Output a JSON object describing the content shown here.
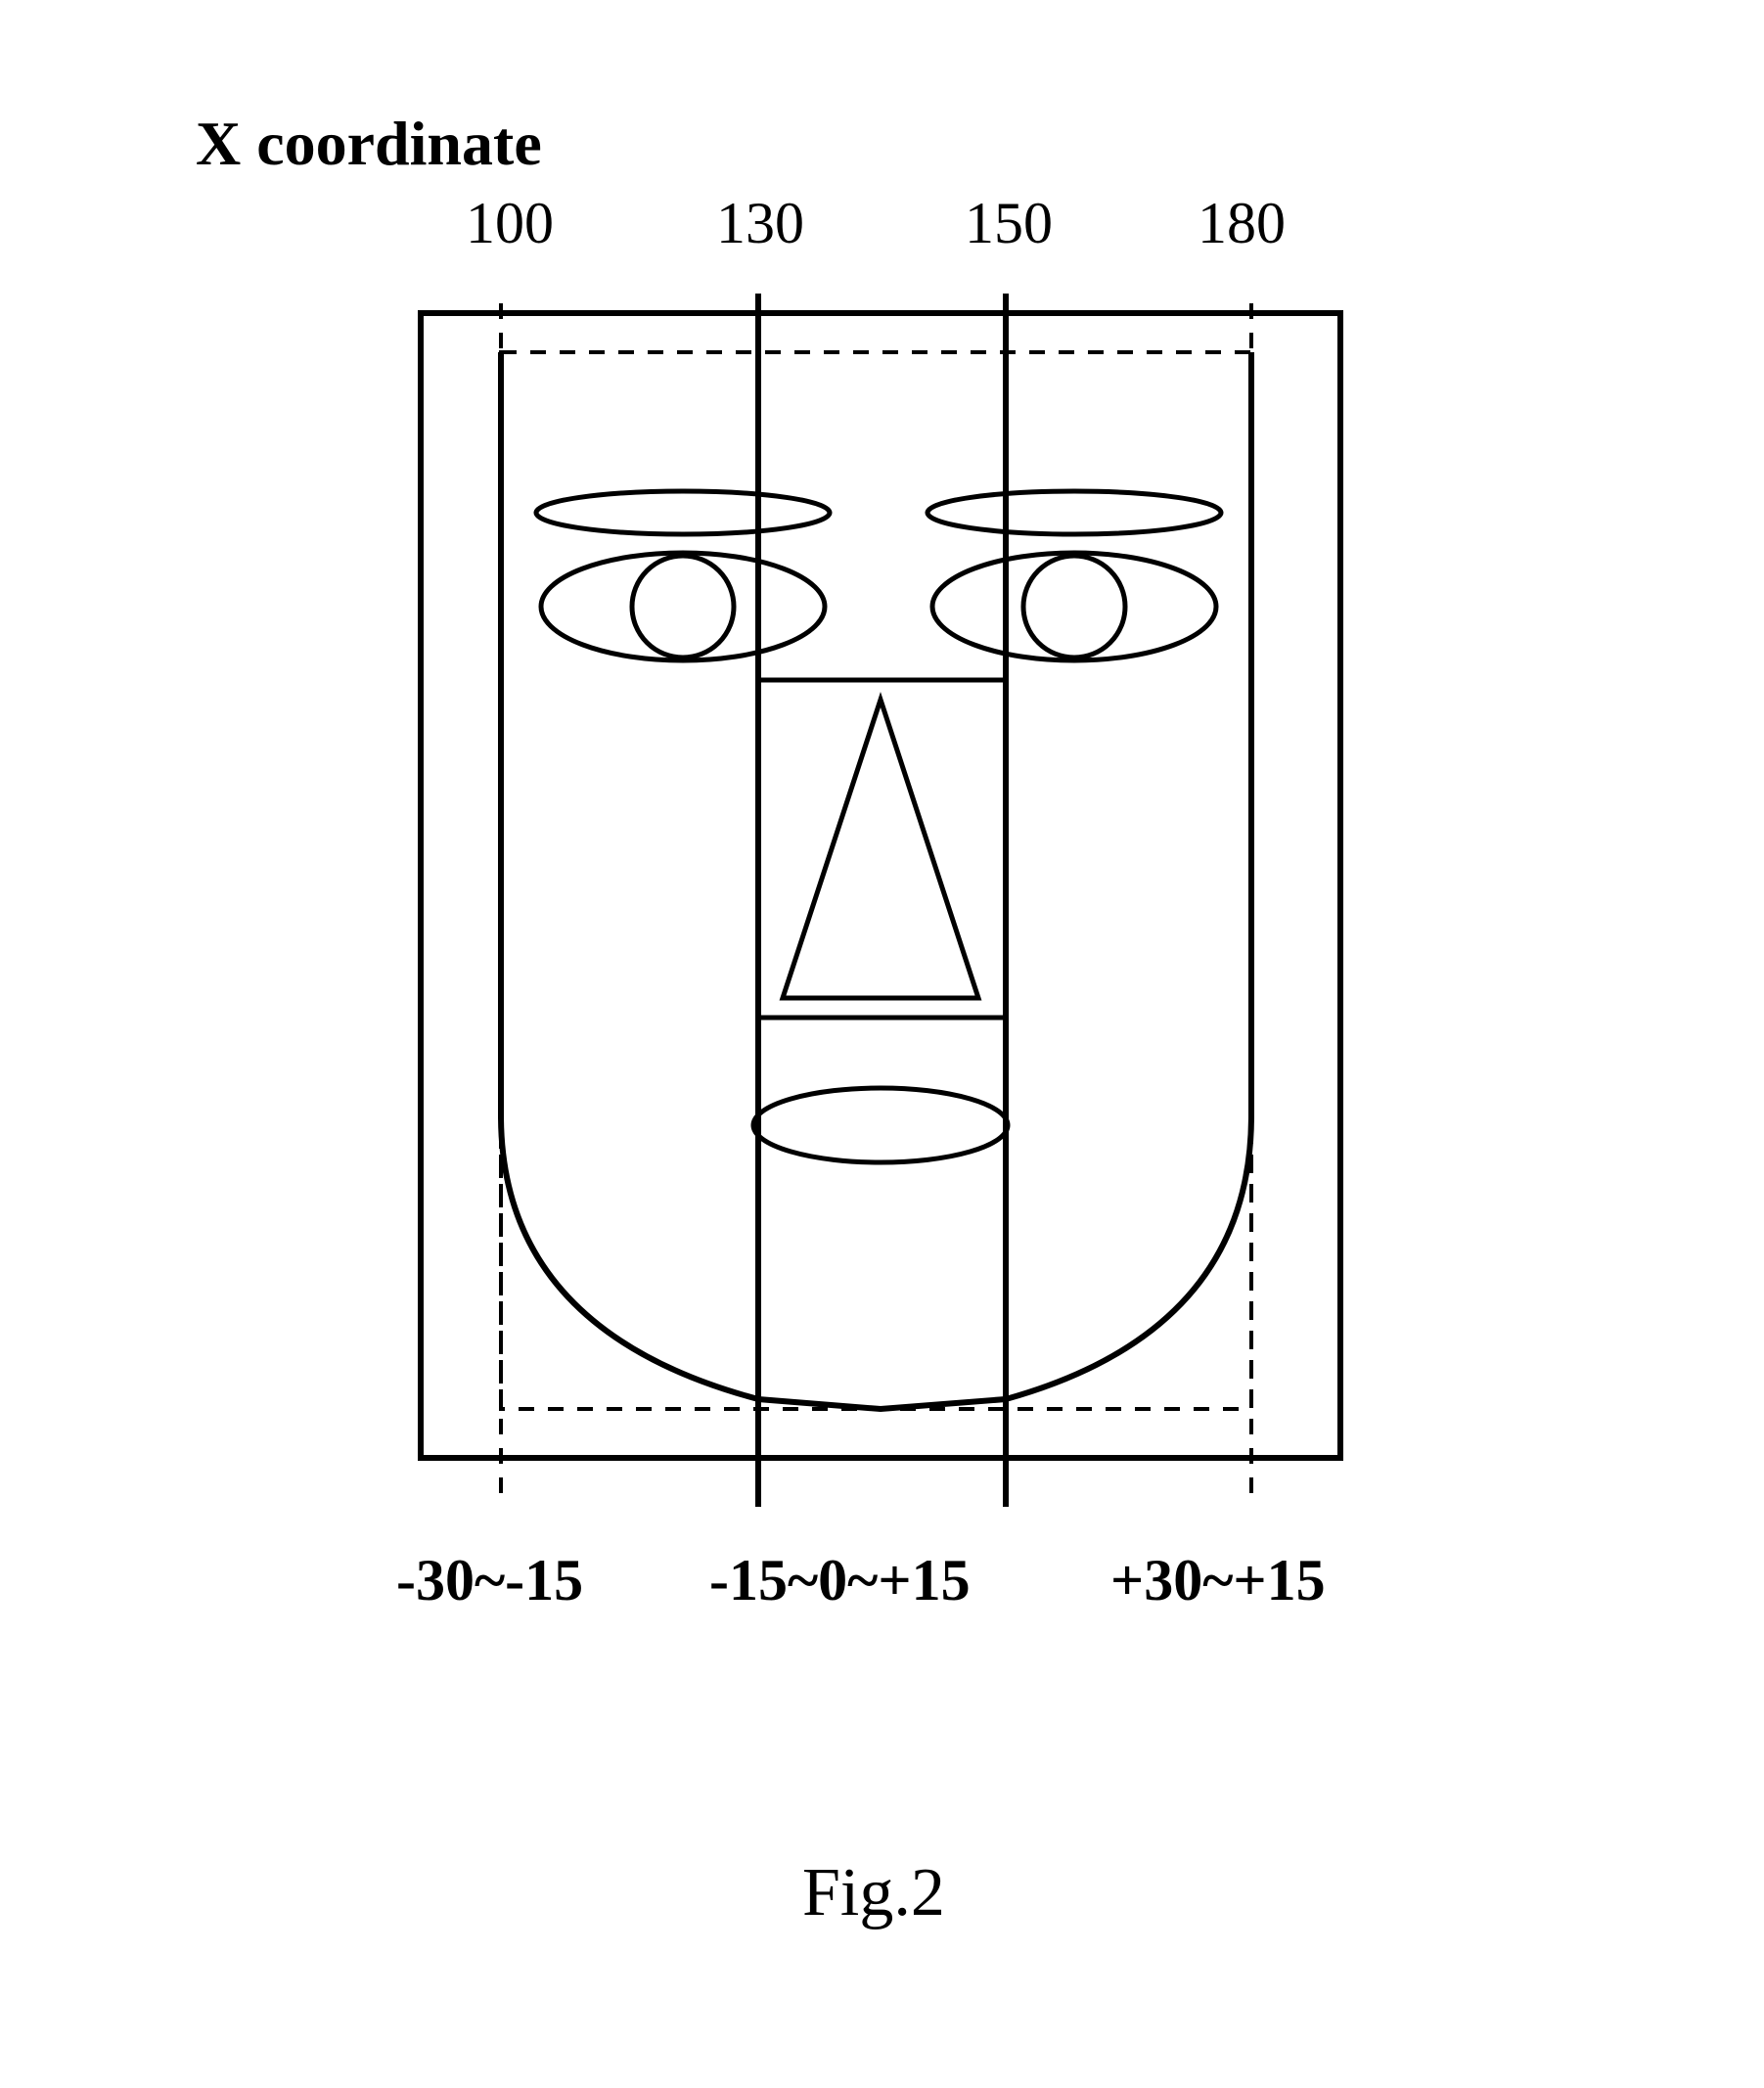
{
  "title": "X coordinate",
  "xticks": {
    "t1": "100",
    "t2": "130",
    "t3": "150",
    "t4": "180"
  },
  "ranges": {
    "left": "-30~-15",
    "center": "-15~0~+15",
    "right": "+30~+15"
  },
  "figure_caption": "Fig.2",
  "explanation": "Face diagram divided by X-coordinate lines at 100, 130, 150, 180 into three angular zones: left zone (-30° to -15°), center zone (-15° to 0° to +15°), right zone (+30° to +15°)."
}
